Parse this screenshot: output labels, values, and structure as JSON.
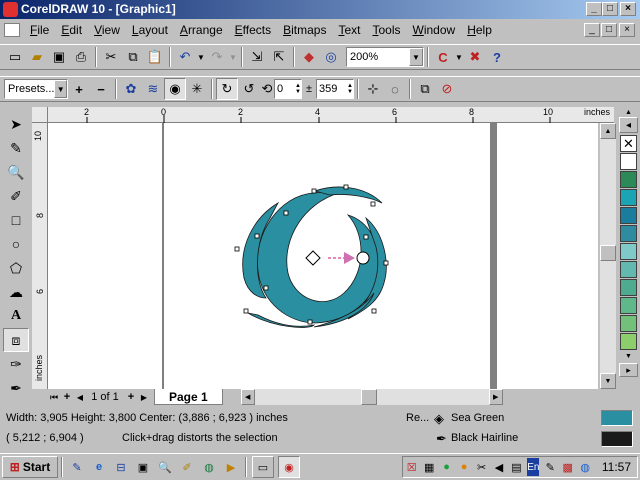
{
  "window": {
    "title": "CorelDRAW 10 - [Graphic1]",
    "controls": [
      "_",
      "□",
      "×"
    ],
    "doc_controls": [
      "_",
      "□",
      "×"
    ]
  },
  "menu": [
    "File",
    "Edit",
    "View",
    "Layout",
    "Arrange",
    "Effects",
    "Bitmaps",
    "Text",
    "Tools",
    "Window",
    "Help"
  ],
  "standard_toolbar": {
    "zoom": "200%"
  },
  "property_bar": {
    "presets": "Presets...",
    "angle": "0",
    "degrees": "359"
  },
  "ruler": {
    "unit": "inches",
    "h_labels": [
      "2",
      "0",
      "2",
      "4",
      "6",
      "8",
      "10"
    ],
    "v_labels": [
      "10",
      "8",
      "6"
    ]
  },
  "pages": {
    "counter": "1 of 1",
    "tab": "Page 1"
  },
  "status": {
    "line1": "Width: 3,905  Height: 3,800  Center: (3,886 ; 6,923 )  inches",
    "coords": "( 5,212 ; 6,904 )",
    "hint": "Click+drag distorts the selection",
    "re_label": "Re...",
    "fill_name": "Sea Green",
    "outline_name": "Black  Hairline",
    "fill_color": "#2a8fa0",
    "outline_color": "#1a1a1a"
  },
  "palette_colors": [
    "#ffffff",
    "#2b8a57",
    "#1aa4b4",
    "#1a7d9d",
    "#2e8ba0",
    "#7fc9c9",
    "#63b8b0",
    "#4fab8f",
    "#5eb88a",
    "#72c079",
    "#8ccd6c",
    "#a7d865"
  ],
  "shape_color": "#2a8fa0",
  "taskbar": {
    "start": "Start",
    "lang": "En",
    "clock": "11:57"
  }
}
